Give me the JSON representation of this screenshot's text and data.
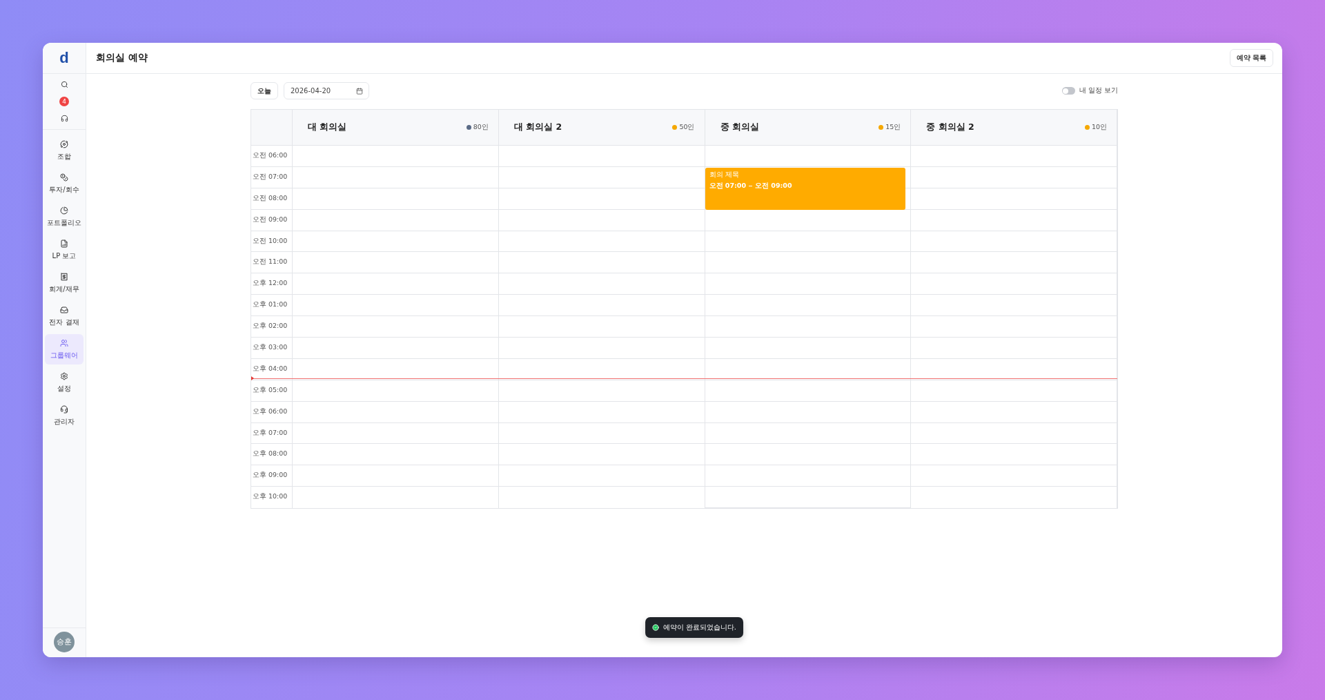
{
  "sidebar": {
    "logo": "d",
    "badge": "4",
    "items": [
      {
        "kind": "users-cycle",
        "label": "조합",
        "selected": false
      },
      {
        "kind": "coins",
        "label": "투자/회수",
        "selected": false
      },
      {
        "kind": "pie",
        "label": "포트폴리오",
        "selected": false
      },
      {
        "kind": "report",
        "label": "LP 보고",
        "selected": false
      },
      {
        "kind": "receipt",
        "label": "회계/재무",
        "selected": false
      },
      {
        "kind": "inbox",
        "label": "전자 결재",
        "selected": false
      },
      {
        "kind": "users",
        "label": "그룹웨어",
        "selected": true
      },
      {
        "kind": "gear",
        "label": "설정",
        "selected": false
      },
      {
        "kind": "headset",
        "label": "관리자",
        "selected": false
      }
    ],
    "avatar": "승훈"
  },
  "header": {
    "title": "회의실 예약",
    "button": "예약 목록"
  },
  "toolbar": {
    "today_button": "오늘",
    "date": "2026-04-20",
    "toggle": {
      "label": "내 일정 보기",
      "on": false
    }
  },
  "times": [
    {
      "label": "오전 06:00",
      "current": false
    },
    {
      "label": "오전 07:00",
      "current": false
    },
    {
      "label": "오전 08:00",
      "current": false
    },
    {
      "label": "오전 09:00",
      "current": false
    },
    {
      "label": "오전 10:00",
      "current": false
    },
    {
      "label": "오전 11:00",
      "current": false
    },
    {
      "label": "오후 12:00",
      "current": false
    },
    {
      "label": "오후 01:00",
      "current": false
    },
    {
      "label": "오후 02:00",
      "current": false
    },
    {
      "label": "오후 03:00",
      "current": false
    },
    {
      "label": "오후 04:00",
      "current": true
    },
    {
      "label": "오후 05:00",
      "current": false
    },
    {
      "label": "오후 06:00",
      "current": false
    },
    {
      "label": "오후 07:00",
      "current": false
    },
    {
      "label": "오후 08:00",
      "current": false
    },
    {
      "label": "오후 09:00",
      "current": false
    },
    {
      "label": "오후 10:00",
      "current": false
    }
  ],
  "rooms": [
    {
      "name": "대 회의실",
      "capacity": "80인",
      "color": "#5b6b86"
    },
    {
      "name": "대 회의실 2",
      "capacity": "50인",
      "color": "#f5a800"
    },
    {
      "name": "중 회의실",
      "capacity": "15인",
      "color": "#f5a800",
      "events": [
        {
          "title": "회의 제목",
          "start": "오전 07:00",
          "end": "오전 09:00"
        }
      ]
    },
    {
      "name": "중 회의실 2",
      "capacity": "10인",
      "color": "#f5a800"
    }
  ],
  "toast": {
    "message": "예약이 완료되었습니다."
  }
}
